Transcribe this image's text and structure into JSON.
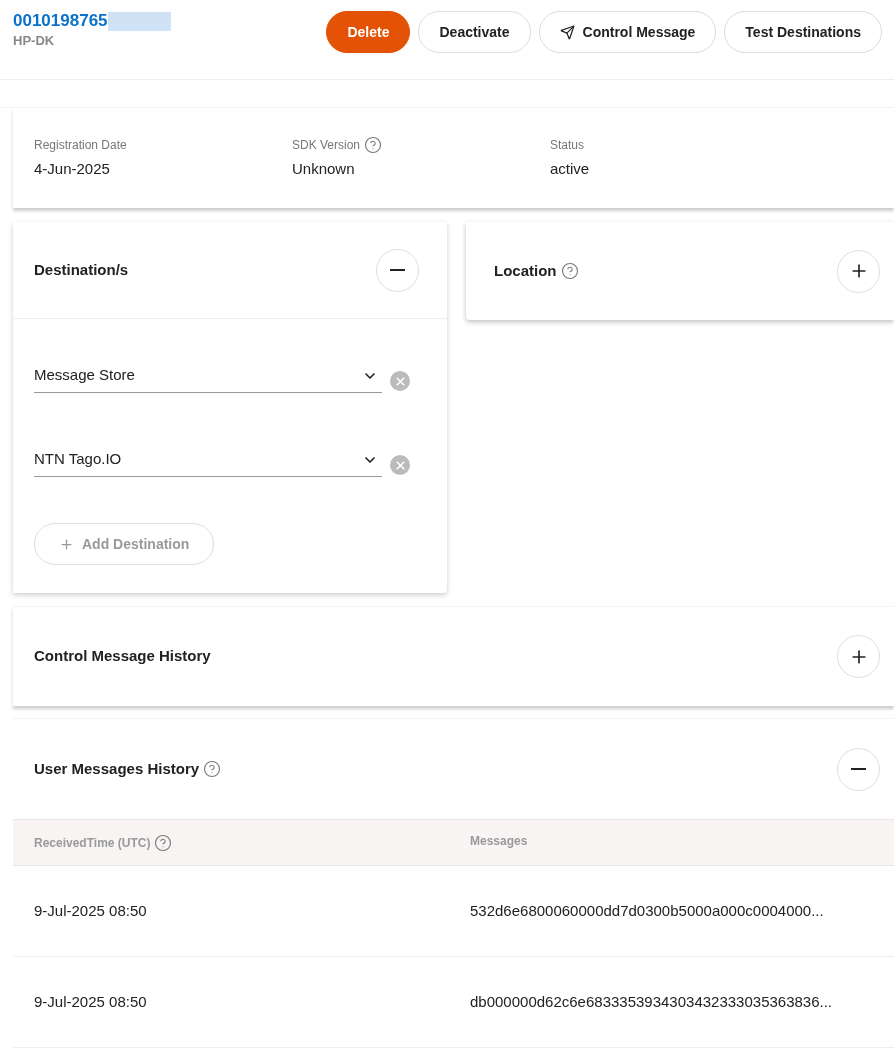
{
  "device": {
    "id": "0010198765",
    "name": "HP-DK"
  },
  "actions": [
    {
      "label": "Delete",
      "kind": "danger"
    },
    {
      "label": "Deactivate",
      "kind": "plain"
    },
    {
      "label": "Control Message",
      "kind": "send"
    },
    {
      "label": "Test Destinations",
      "kind": "plain"
    }
  ],
  "info": [
    {
      "label": "Registration Date",
      "value": "4-Jun-2025",
      "help": false
    },
    {
      "label": "SDK Version",
      "value": "Unknown",
      "help": true
    },
    {
      "label": "Status",
      "value": "active",
      "help": false
    }
  ],
  "destinations": {
    "title": "Destination/s",
    "expanded": true,
    "items": [
      {
        "value": "Message Store"
      },
      {
        "value": "NTN Tago.IO"
      }
    ],
    "add_label": "Add Destination"
  },
  "location": {
    "title": "Location",
    "expanded": false
  },
  "control_history": {
    "title": "Control Message History",
    "expanded": false
  },
  "user_history": {
    "title": "User Messages History",
    "expanded": true,
    "columns": [
      {
        "label": "ReceivedTime (UTC)",
        "help": true
      },
      {
        "label": "Messages",
        "help": false
      }
    ],
    "rows": [
      [
        "9-Jul-2025 08:50",
        "532d6e6800060000dd7d0300b5000a000c0004000..."
      ],
      [
        "9-Jul-2025 08:50",
        "db000000d62c6e6833353934303432333035363836..."
      ]
    ]
  }
}
